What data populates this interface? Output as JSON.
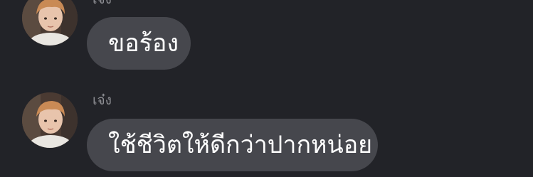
{
  "messages": [
    {
      "sender": "เจ๋ง",
      "text": "ขอร้อง"
    },
    {
      "sender": "เจ๋ง",
      "text": "ใช้ชีวิตให้ดีกว่าปากหน่อย"
    }
  ],
  "colors": {
    "background": "#222328",
    "bubble": "#46474d",
    "text": "#ffffff",
    "sender": "#8e8f94"
  }
}
